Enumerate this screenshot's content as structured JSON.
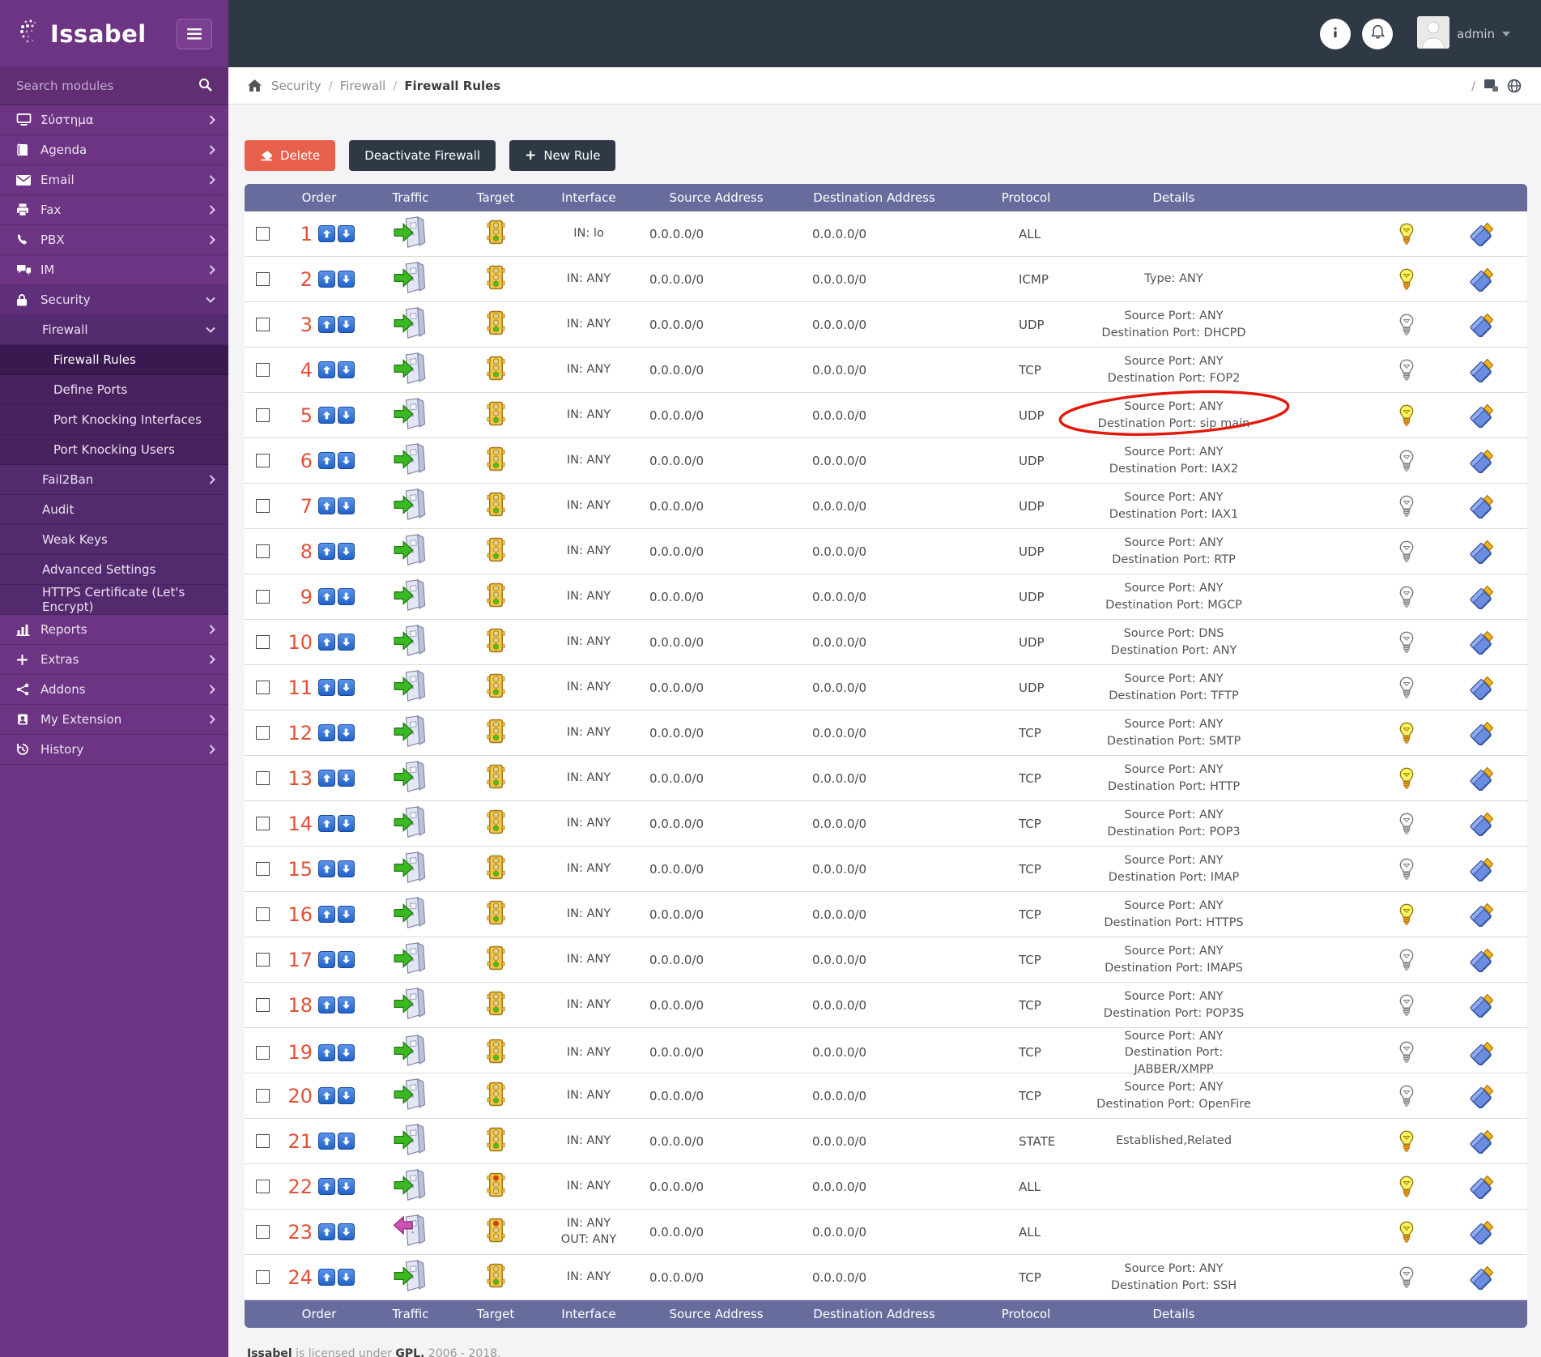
{
  "brand": {
    "name": "Issabel"
  },
  "topbar": {
    "user": "admin"
  },
  "sidebar": {
    "search_placeholder": "Search modules",
    "items": [
      {
        "label": "Σύστημα",
        "icon": "system",
        "level": 1,
        "chevron": "right"
      },
      {
        "label": "Agenda",
        "icon": "agenda",
        "level": 1,
        "chevron": "right"
      },
      {
        "label": "Email",
        "icon": "email",
        "level": 1,
        "chevron": "right"
      },
      {
        "label": "Fax",
        "icon": "fax",
        "level": 1,
        "chevron": "right"
      },
      {
        "label": "PBX",
        "icon": "pbx",
        "level": 1,
        "chevron": "right"
      },
      {
        "label": "IM",
        "icon": "im",
        "level": 1,
        "chevron": "right"
      },
      {
        "label": "Security",
        "icon": "security",
        "level": 1,
        "chevron": "down",
        "expanded": true
      },
      {
        "label": "Firewall",
        "icon": null,
        "level": 2,
        "chevron": "down"
      },
      {
        "label": "Firewall Rules",
        "icon": null,
        "level": 3,
        "active": true
      },
      {
        "label": "Define Ports",
        "icon": null,
        "level": 3
      },
      {
        "label": "Port Knocking Interfaces",
        "icon": null,
        "level": 3
      },
      {
        "label": "Port Knocking Users",
        "icon": null,
        "level": 3
      },
      {
        "label": "Fail2Ban",
        "icon": null,
        "level": 2,
        "chevron": "right"
      },
      {
        "label": "Audit",
        "icon": null,
        "level": 2
      },
      {
        "label": "Weak Keys",
        "icon": null,
        "level": 2
      },
      {
        "label": "Advanced Settings",
        "icon": null,
        "level": 2
      },
      {
        "label": "HTTPS Certificate (Let's Encrypt)",
        "icon": null,
        "level": 2
      },
      {
        "label": "Reports",
        "icon": "reports",
        "level": 1,
        "chevron": "right"
      },
      {
        "label": "Extras",
        "icon": "extras",
        "level": 1,
        "chevron": "right"
      },
      {
        "label": "Addons",
        "icon": "addons",
        "level": 1,
        "chevron": "right"
      },
      {
        "label": "My Extension",
        "icon": "myext",
        "level": 1,
        "chevron": "right"
      },
      {
        "label": "History",
        "icon": "history",
        "level": 1,
        "chevron": "right"
      }
    ]
  },
  "breadcrumb": {
    "items": [
      "Security",
      "Firewall",
      "Firewall Rules"
    ],
    "separator": "/"
  },
  "toolbar": {
    "delete_label": "Delete",
    "deactivate_label": "Deactivate Firewall",
    "new_rule_label": "New Rule"
  },
  "table": {
    "columns": [
      "Order",
      "Traffic",
      "Target",
      "Interface",
      "Source Address",
      "Destination Address",
      "Protocol",
      "Details"
    ],
    "annotation_color": "#e3180b",
    "rows": [
      {
        "order": 1,
        "traffic": "in",
        "target": "green",
        "interface": [
          "IN: lo"
        ],
        "source": "0.0.0.0/0",
        "destination": "0.0.0.0/0",
        "protocol": "ALL",
        "details": [],
        "bulb": "on"
      },
      {
        "order": 2,
        "traffic": "in",
        "target": "green",
        "interface": [
          "IN: ANY"
        ],
        "source": "0.0.0.0/0",
        "destination": "0.0.0.0/0",
        "protocol": "ICMP",
        "details": [
          "Type: ANY"
        ],
        "bulb": "on"
      },
      {
        "order": 3,
        "traffic": "in",
        "target": "green",
        "interface": [
          "IN: ANY"
        ],
        "source": "0.0.0.0/0",
        "destination": "0.0.0.0/0",
        "protocol": "UDP",
        "details": [
          "Source Port: ANY",
          "Destination Port: DHCPD"
        ],
        "bulb": "off"
      },
      {
        "order": 4,
        "traffic": "in",
        "target": "green",
        "interface": [
          "IN: ANY"
        ],
        "source": "0.0.0.0/0",
        "destination": "0.0.0.0/0",
        "protocol": "TCP",
        "details": [
          "Source Port: ANY",
          "Destination Port: FOP2"
        ],
        "bulb": "off"
      },
      {
        "order": 5,
        "traffic": "in",
        "target": "green",
        "interface": [
          "IN: ANY"
        ],
        "source": "0.0.0.0/0",
        "destination": "0.0.0.0/0",
        "protocol": "UDP",
        "details": [
          "Source Port: ANY",
          "Destination Port: sip main"
        ],
        "bulb": "on",
        "annotated": true
      },
      {
        "order": 6,
        "traffic": "in",
        "target": "green",
        "interface": [
          "IN: ANY"
        ],
        "source": "0.0.0.0/0",
        "destination": "0.0.0.0/0",
        "protocol": "UDP",
        "details": [
          "Source Port: ANY",
          "Destination Port: IAX2"
        ],
        "bulb": "off"
      },
      {
        "order": 7,
        "traffic": "in",
        "target": "green",
        "interface": [
          "IN: ANY"
        ],
        "source": "0.0.0.0/0",
        "destination": "0.0.0.0/0",
        "protocol": "UDP",
        "details": [
          "Source Port: ANY",
          "Destination Port: IAX1"
        ],
        "bulb": "off"
      },
      {
        "order": 8,
        "traffic": "in",
        "target": "green",
        "interface": [
          "IN: ANY"
        ],
        "source": "0.0.0.0/0",
        "destination": "0.0.0.0/0",
        "protocol": "UDP",
        "details": [
          "Source Port: ANY",
          "Destination Port: RTP"
        ],
        "bulb": "off"
      },
      {
        "order": 9,
        "traffic": "in",
        "target": "green",
        "interface": [
          "IN: ANY"
        ],
        "source": "0.0.0.0/0",
        "destination": "0.0.0.0/0",
        "protocol": "UDP",
        "details": [
          "Source Port: ANY",
          "Destination Port: MGCP"
        ],
        "bulb": "off"
      },
      {
        "order": 10,
        "traffic": "in",
        "target": "green",
        "interface": [
          "IN: ANY"
        ],
        "source": "0.0.0.0/0",
        "destination": "0.0.0.0/0",
        "protocol": "UDP",
        "details": [
          "Source Port: DNS",
          "Destination Port: ANY"
        ],
        "bulb": "off"
      },
      {
        "order": 11,
        "traffic": "in",
        "target": "green",
        "interface": [
          "IN: ANY"
        ],
        "source": "0.0.0.0/0",
        "destination": "0.0.0.0/0",
        "protocol": "UDP",
        "details": [
          "Source Port: ANY",
          "Destination Port: TFTP"
        ],
        "bulb": "off"
      },
      {
        "order": 12,
        "traffic": "in",
        "target": "green",
        "interface": [
          "IN: ANY"
        ],
        "source": "0.0.0.0/0",
        "destination": "0.0.0.0/0",
        "protocol": "TCP",
        "details": [
          "Source Port: ANY",
          "Destination Port: SMTP"
        ],
        "bulb": "on"
      },
      {
        "order": 13,
        "traffic": "in",
        "target": "green",
        "interface": [
          "IN: ANY"
        ],
        "source": "0.0.0.0/0",
        "destination": "0.0.0.0/0",
        "protocol": "TCP",
        "details": [
          "Source Port: ANY",
          "Destination Port: HTTP"
        ],
        "bulb": "on"
      },
      {
        "order": 14,
        "traffic": "in",
        "target": "green",
        "interface": [
          "IN: ANY"
        ],
        "source": "0.0.0.0/0",
        "destination": "0.0.0.0/0",
        "protocol": "TCP",
        "details": [
          "Source Port: ANY",
          "Destination Port: POP3"
        ],
        "bulb": "off"
      },
      {
        "order": 15,
        "traffic": "in",
        "target": "green",
        "interface": [
          "IN: ANY"
        ],
        "source": "0.0.0.0/0",
        "destination": "0.0.0.0/0",
        "protocol": "TCP",
        "details": [
          "Source Port: ANY",
          "Destination Port: IMAP"
        ],
        "bulb": "off"
      },
      {
        "order": 16,
        "traffic": "in",
        "target": "green",
        "interface": [
          "IN: ANY"
        ],
        "source": "0.0.0.0/0",
        "destination": "0.0.0.0/0",
        "protocol": "TCP",
        "details": [
          "Source Port: ANY",
          "Destination Port: HTTPS"
        ],
        "bulb": "on"
      },
      {
        "order": 17,
        "traffic": "in",
        "target": "green",
        "interface": [
          "IN: ANY"
        ],
        "source": "0.0.0.0/0",
        "destination": "0.0.0.0/0",
        "protocol": "TCP",
        "details": [
          "Source Port: ANY",
          "Destination Port: IMAPS"
        ],
        "bulb": "off"
      },
      {
        "order": 18,
        "traffic": "in",
        "target": "green",
        "interface": [
          "IN: ANY"
        ],
        "source": "0.0.0.0/0",
        "destination": "0.0.0.0/0",
        "protocol": "TCP",
        "details": [
          "Source Port: ANY",
          "Destination Port: POP3S"
        ],
        "bulb": "off"
      },
      {
        "order": 19,
        "traffic": "in",
        "target": "green",
        "interface": [
          "IN: ANY"
        ],
        "source": "0.0.0.0/0",
        "destination": "0.0.0.0/0",
        "protocol": "TCP",
        "details": [
          "Source Port: ANY",
          "Destination Port: JABBER/XMPP"
        ],
        "bulb": "off"
      },
      {
        "order": 20,
        "traffic": "in",
        "target": "green",
        "interface": [
          "IN: ANY"
        ],
        "source": "0.0.0.0/0",
        "destination": "0.0.0.0/0",
        "protocol": "TCP",
        "details": [
          "Source Port: ANY",
          "Destination Port: OpenFire"
        ],
        "bulb": "off"
      },
      {
        "order": 21,
        "traffic": "in",
        "target": "green",
        "interface": [
          "IN: ANY"
        ],
        "source": "0.0.0.0/0",
        "destination": "0.0.0.0/0",
        "protocol": "STATE",
        "details": [
          "Established,Related"
        ],
        "bulb": "on"
      },
      {
        "order": 22,
        "traffic": "in",
        "target": "red",
        "interface": [
          "IN: ANY"
        ],
        "source": "0.0.0.0/0",
        "destination": "0.0.0.0/0",
        "protocol": "ALL",
        "details": [],
        "bulb": "on"
      },
      {
        "order": 23,
        "traffic": "out",
        "target": "red",
        "interface": [
          "IN: ANY",
          "OUT: ANY"
        ],
        "source": "0.0.0.0/0",
        "destination": "0.0.0.0/0",
        "protocol": "ALL",
        "details": [],
        "bulb": "on"
      },
      {
        "order": 24,
        "traffic": "in",
        "target": "green",
        "interface": [
          "IN: ANY"
        ],
        "source": "0.0.0.0/0",
        "destination": "0.0.0.0/0",
        "protocol": "TCP",
        "details": [
          "Source Port: ANY",
          "Destination Port: SSH"
        ],
        "bulb": "off"
      }
    ]
  },
  "footer": {
    "brand": "Issabel",
    "licensed": "is licensed under",
    "gpl": "GPL.",
    "years": "2006 - 2018."
  }
}
